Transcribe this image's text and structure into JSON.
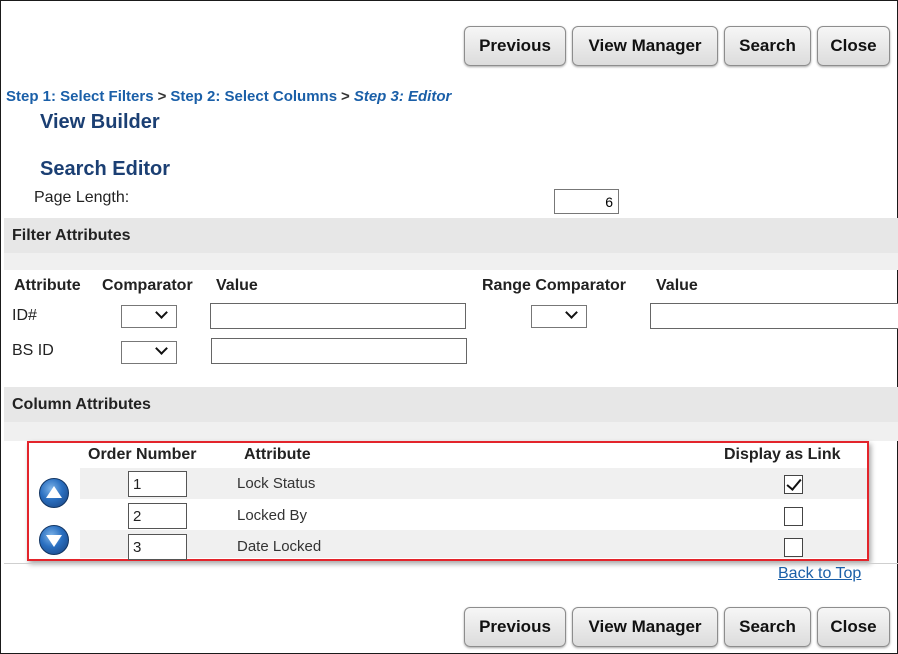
{
  "buttons": {
    "previous": "Previous",
    "view_manager": "View Manager",
    "search": "Search",
    "close": "Close"
  },
  "breadcrumb": {
    "step1": "Step 1: Select Filters",
    "separator": ">",
    "step2": "Step 2: Select Columns",
    "step3": "Step 3: Editor"
  },
  "headings": {
    "view_builder": "View Builder",
    "search_editor": "Search Editor"
  },
  "page_length": {
    "label": "Page Length:",
    "value": "6"
  },
  "filter_section": {
    "title": "Filter Attributes",
    "headers": {
      "attribute": "Attribute",
      "comparator": "Comparator",
      "value": "Value",
      "range_comparator": "Range Comparator",
      "range_value": "Value"
    },
    "rows": [
      {
        "attribute": "ID#",
        "comparator": "",
        "value": "",
        "range_comparator": "",
        "range_value": ""
      },
      {
        "attribute": "BS ID",
        "comparator": "",
        "value": ""
      }
    ]
  },
  "column_section": {
    "title": "Column Attributes",
    "headers": {
      "order_number": "Order Number",
      "attribute": "Attribute",
      "display_as_link": "Display as Link"
    },
    "rows": [
      {
        "order": "1",
        "attribute": "Lock Status",
        "display_as_link": true
      },
      {
        "order": "2",
        "attribute": "Locked By",
        "display_as_link": false
      },
      {
        "order": "3",
        "attribute": "Date Locked",
        "display_as_link": false
      }
    ]
  },
  "back_to_top": "Back to Top",
  "colors": {
    "link_blue": "#1a5fa8",
    "heading_navy": "#1b3f73",
    "section_gray": "#e7e7e7",
    "highlight_red": "#e3242b"
  },
  "icons": {
    "move_up": "arrow-up-circle-icon",
    "move_down": "arrow-down-circle-icon",
    "dropdown": "chevron-down-icon",
    "check": "checkmark-icon"
  }
}
